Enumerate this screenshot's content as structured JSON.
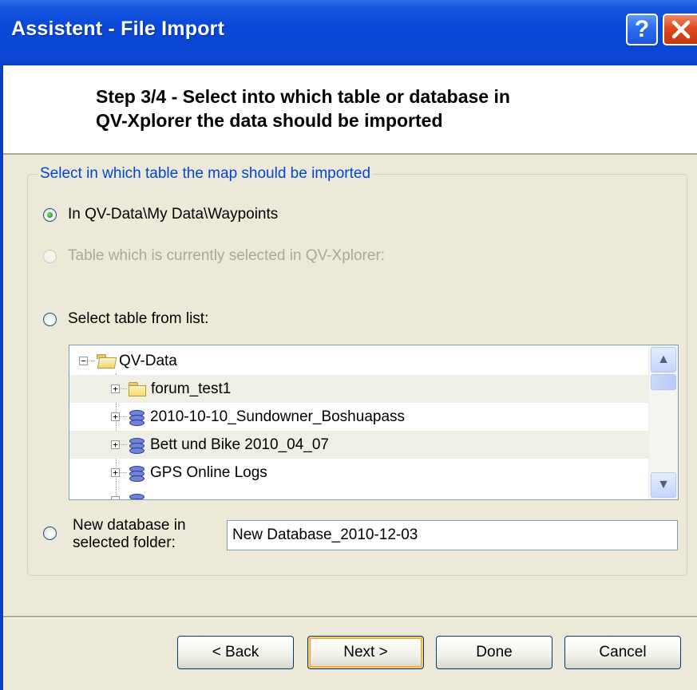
{
  "window": {
    "title": "Assistent - File Import",
    "help_icon": "question-mark",
    "close_icon": "x-close"
  },
  "header": {
    "step_title": "Step 3/4 - Select into which table or database in\nQV-Xplorer the data should be imported"
  },
  "group": {
    "legend": "Select in which table the map should be imported",
    "options": [
      {
        "label": "In QV-Data\\My Data\\Waypoints",
        "selected": true,
        "enabled": true
      },
      {
        "label": "Table which is currently selected in QV-Xplorer:",
        "selected": false,
        "enabled": false
      },
      {
        "label": "Select table from list:",
        "selected": false,
        "enabled": true
      }
    ],
    "tree": {
      "root": {
        "label": "QV-Data",
        "icon": "folder-open-icon",
        "expander": "−"
      },
      "items": [
        {
          "label": "forum_test1",
          "icon": "folder-icon",
          "expander": "+"
        },
        {
          "label": "2010-10-10_Sundowner_Boshuapass",
          "icon": "database-icon",
          "expander": "+"
        },
        {
          "label": "Bett und Bike 2010_04_07",
          "icon": "database-icon",
          "expander": "+"
        },
        {
          "label": "GPS Online Logs",
          "icon": "database-icon",
          "expander": "+"
        }
      ],
      "scroll_up_icon": "▲",
      "scroll_down_icon": "▼"
    },
    "new_database": {
      "label": "New database in\nselected folder:",
      "value": "New Database_2010-12-03"
    }
  },
  "footer": {
    "back_label": "< Back",
    "next_label": "Next >",
    "done_label": "Done",
    "cancel_label": "Cancel"
  },
  "colors": {
    "titlebar": "#0a46d4",
    "legend_text": "#0046d5",
    "dialog_bg": "#ece9d8"
  }
}
